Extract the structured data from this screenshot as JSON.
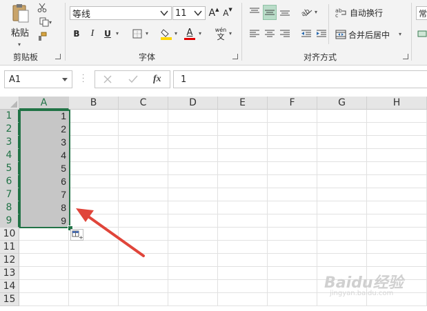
{
  "ribbon": {
    "clipboard": {
      "paste_label": "粘贴",
      "group_label": "剪贴板"
    },
    "font": {
      "font_name": "等线",
      "font_size": "11",
      "bold": "B",
      "italic": "I",
      "underline": "U",
      "font_color_glyph": "A",
      "phonetic_glyph": "wén",
      "phonetic_char": "文",
      "grow": "A",
      "shrink": "A",
      "group_label": "字体"
    },
    "alignment": {
      "wrap_text": "自动换行",
      "merge_center": "合并后居中",
      "group_label": "对齐方式"
    },
    "number": {
      "format_partial": "常"
    }
  },
  "formula_bar": {
    "name_box": "A1",
    "fx": "fx",
    "formula": "1"
  },
  "grid": {
    "columns": [
      "A",
      "B",
      "C",
      "D",
      "E",
      "F",
      "G",
      "H"
    ],
    "rows": [
      "1",
      "2",
      "3",
      "4",
      "5",
      "6",
      "7",
      "8",
      "9",
      "10",
      "11",
      "12",
      "13",
      "14",
      "15"
    ],
    "column_a_values": [
      "1",
      "2",
      "3",
      "4",
      "5",
      "6",
      "7",
      "8",
      "9"
    ]
  },
  "watermark": {
    "brand": "Baidu经验",
    "url": "jingyan.baidu.com"
  },
  "colors": {
    "accent": "#217346",
    "selection_fill": "#c6c6c6",
    "arrow": "#e0453a",
    "highlight_button": "#b9dcc8"
  }
}
